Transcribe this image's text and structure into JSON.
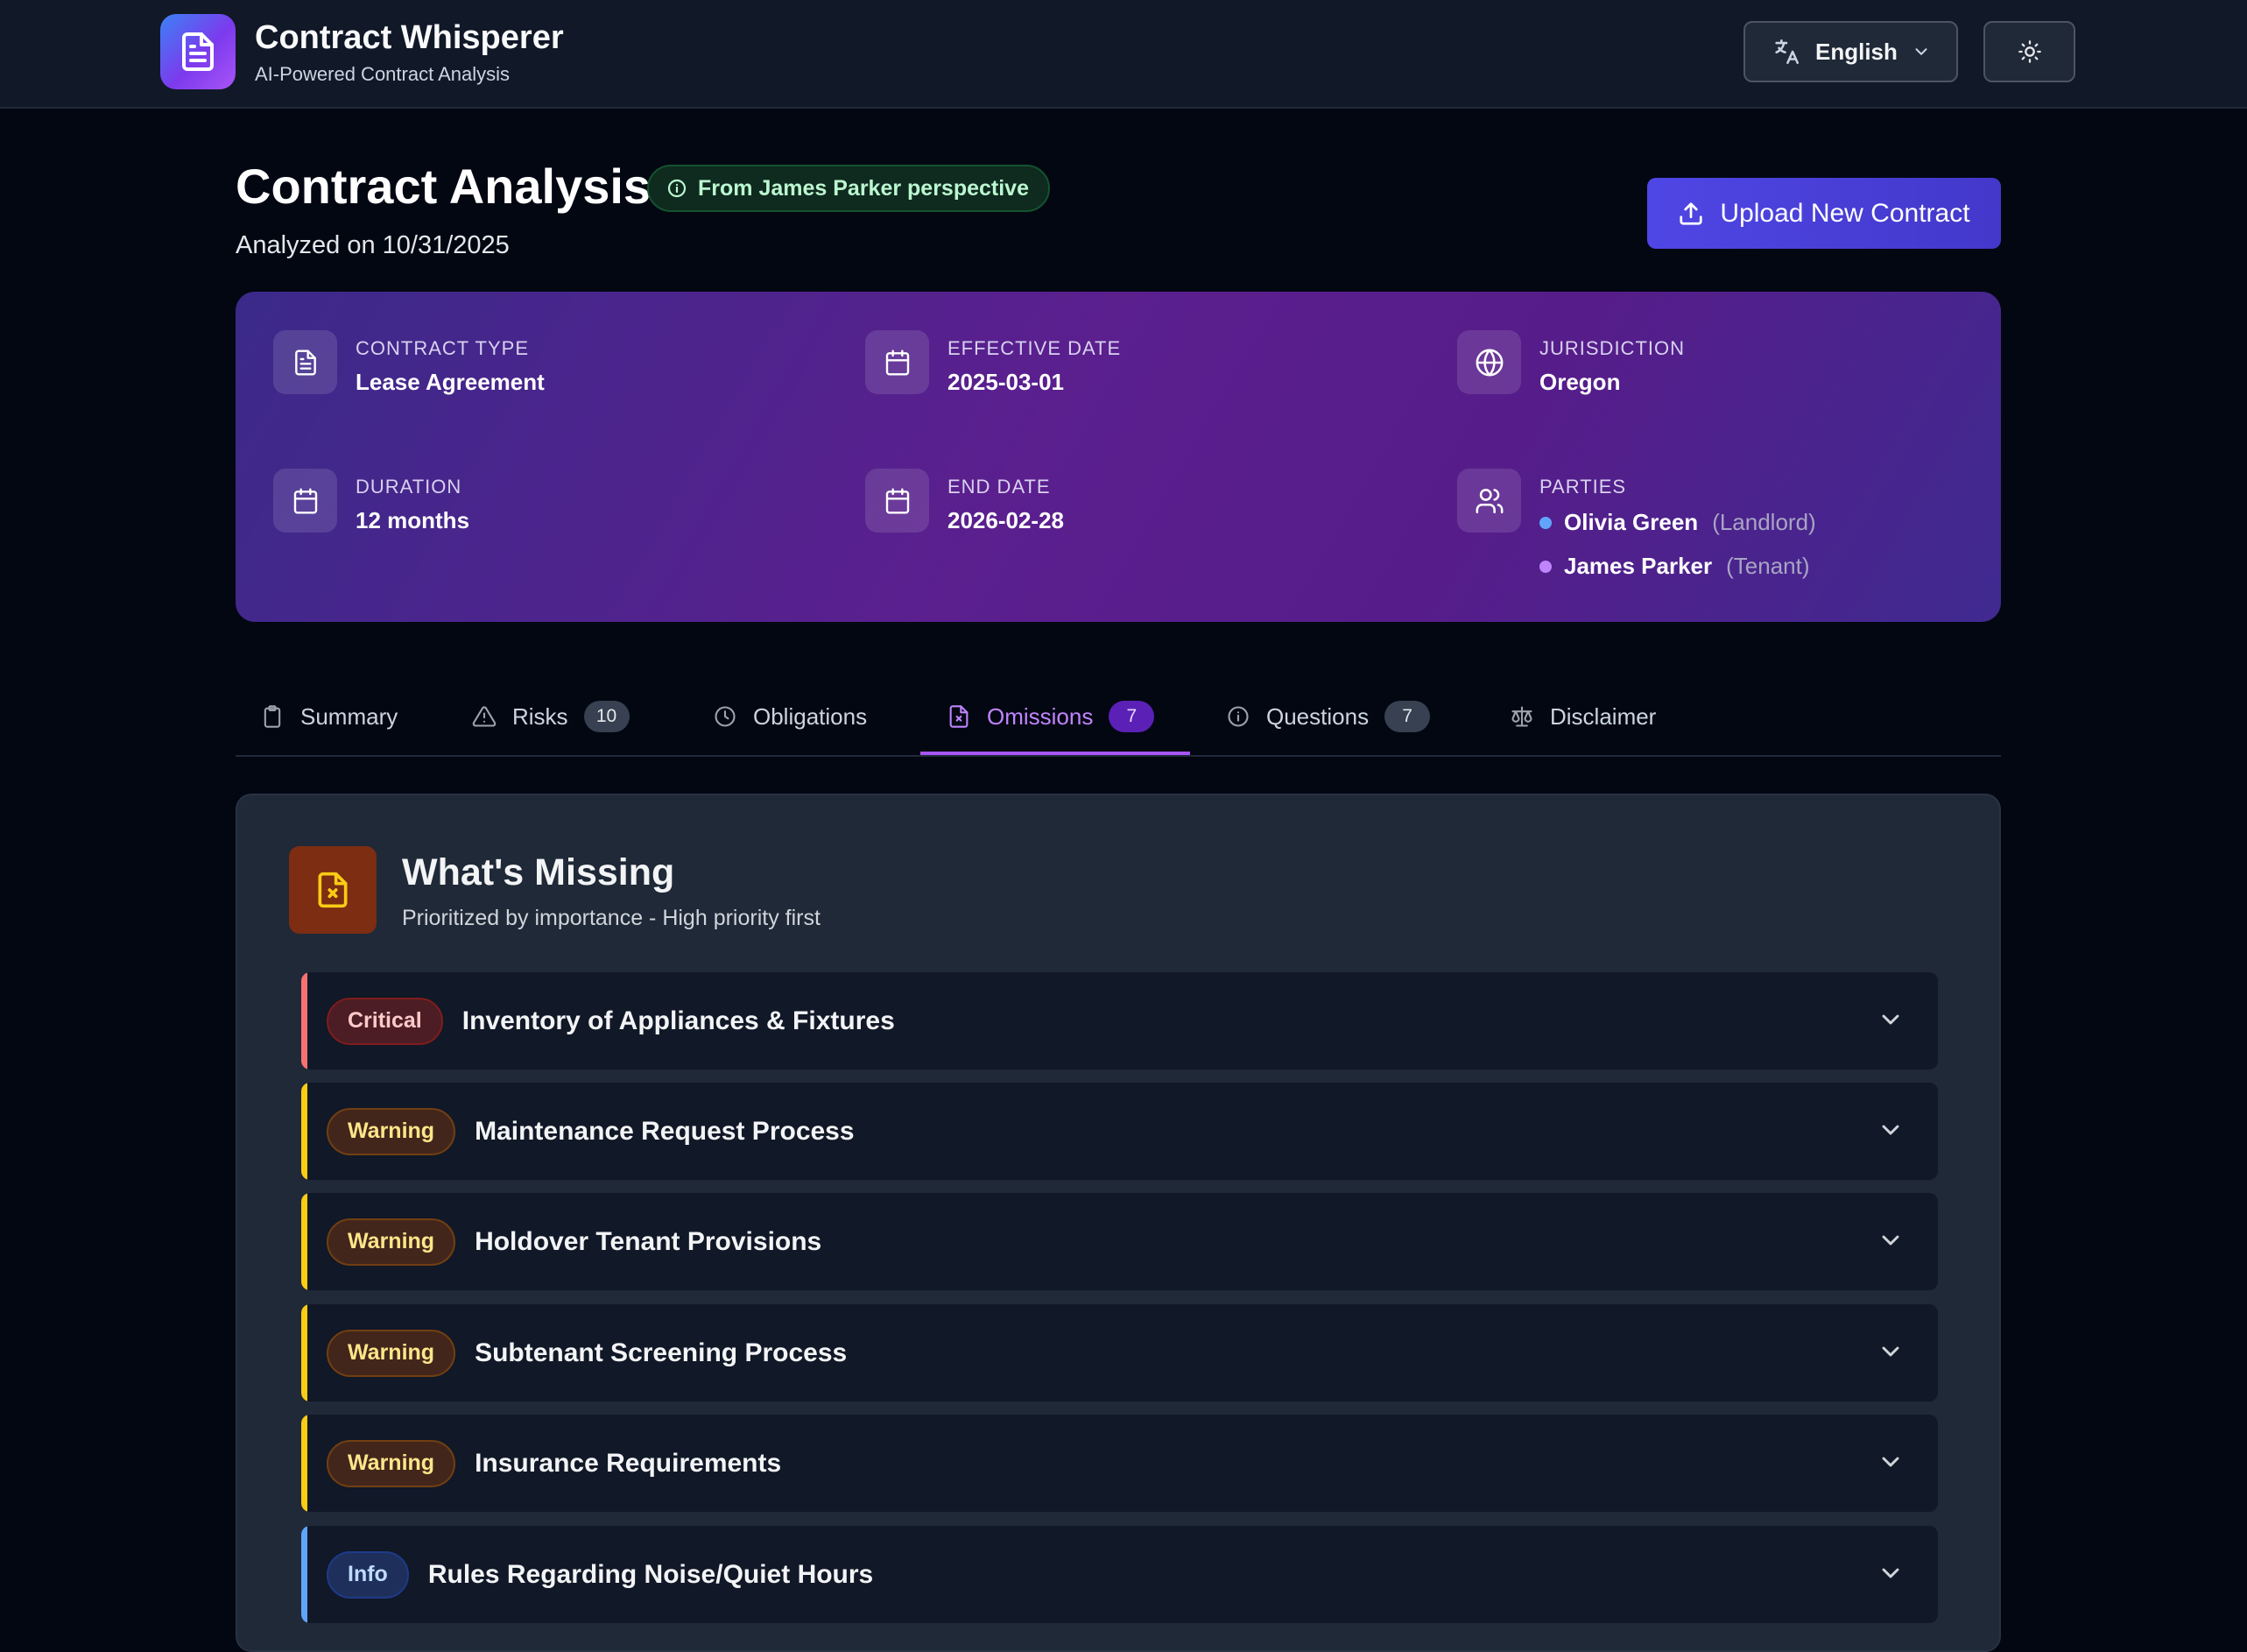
{
  "header": {
    "app_title": "Contract Whisperer",
    "app_subtitle": "AI-Powered Contract Analysis",
    "language": "English"
  },
  "page": {
    "title": "Contract Analysis",
    "perspective": "From James Parker perspective",
    "analyzed_on": "Analyzed on 10/31/2025",
    "upload_label": "Upload New Contract"
  },
  "meta": {
    "contract_type": {
      "label": "CONTRACT TYPE",
      "value": "Lease Agreement"
    },
    "effective_date": {
      "label": "EFFECTIVE DATE",
      "value": "2025-03-01"
    },
    "jurisdiction": {
      "label": "JURISDICTION",
      "value": "Oregon"
    },
    "duration": {
      "label": "DURATION",
      "value": "12 months"
    },
    "end_date": {
      "label": "END DATE",
      "value": "2026-02-28"
    },
    "parties": {
      "label": "PARTIES",
      "items": [
        {
          "name": "Olivia Green",
          "role": "(Landlord)",
          "color": "#60a5fa"
        },
        {
          "name": "James Parker",
          "role": "(Tenant)",
          "color": "#c084fc"
        }
      ]
    }
  },
  "tabs": [
    {
      "label": "Summary",
      "icon": "clipboard-icon"
    },
    {
      "label": "Risks",
      "badge": "10",
      "icon": "alert-triangle-icon"
    },
    {
      "label": "Obligations",
      "icon": "clock-icon"
    },
    {
      "label": "Omissions",
      "badge": "7",
      "icon": "file-x-icon",
      "active": true
    },
    {
      "label": "Questions",
      "badge": "7",
      "icon": "info-icon"
    },
    {
      "label": "Disclaimer",
      "icon": "scale-icon"
    }
  ],
  "omissions": {
    "title": "What's Missing",
    "subtitle": "Prioritized by importance - High priority first",
    "items": [
      {
        "severity": "Critical",
        "title": "Inventory of Appliances & Fixtures",
        "color": "#f87171"
      },
      {
        "severity": "Warning",
        "title": "Maintenance Request Process",
        "color": "#facc15"
      },
      {
        "severity": "Warning",
        "title": "Holdover Tenant Provisions",
        "color": "#facc15"
      },
      {
        "severity": "Warning",
        "title": "Subtenant Screening Process",
        "color": "#facc15"
      },
      {
        "severity": "Warning",
        "title": "Insurance Requirements",
        "color": "#facc15"
      },
      {
        "severity": "Info",
        "title": "Rules Regarding Noise/Quiet Hours",
        "color": "#60a5fa"
      }
    ]
  }
}
